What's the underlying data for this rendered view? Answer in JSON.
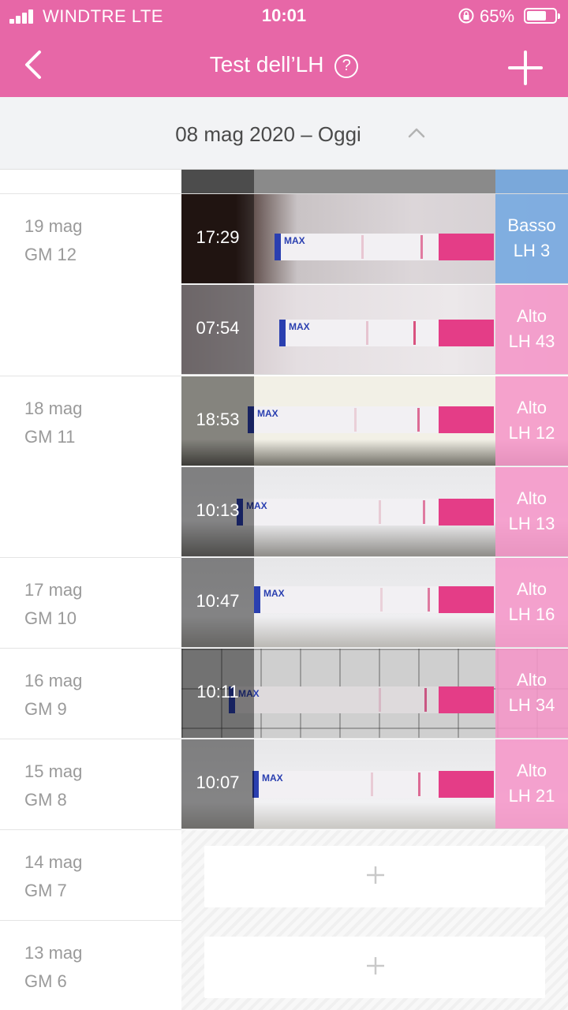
{
  "status": {
    "carrier": "WINDTRE  LTE",
    "time": "10:01",
    "battery_pct": "65%"
  },
  "nav": {
    "title": "Test dell’LH",
    "help_glyph": "?"
  },
  "datebar": {
    "range": "08 mag 2020 – Oggi"
  },
  "colors": {
    "header_pink": "#e767a7",
    "low_blue": "#78aae1",
    "high_pink": "#f596c8"
  },
  "days": [
    {
      "date": "19 mag",
      "gm": "GM 12",
      "tests": [
        {
          "time": "17:29",
          "level": "Basso",
          "lh": "LH 3",
          "status": "low"
        },
        {
          "time": "07:54",
          "level": "Alto",
          "lh": "LH 43",
          "status": "high"
        }
      ]
    },
    {
      "date": "18 mag",
      "gm": "GM 11",
      "tests": [
        {
          "time": "18:53",
          "level": "Alto",
          "lh": "LH 12",
          "status": "high"
        },
        {
          "time": "10:13",
          "level": "Alto",
          "lh": "LH 13",
          "status": "high"
        }
      ]
    },
    {
      "date": "17 mag",
      "gm": "GM 10",
      "tests": [
        {
          "time": "10:47",
          "level": "Alto",
          "lh": "LH 16",
          "status": "high"
        }
      ]
    },
    {
      "date": "16 mag",
      "gm": "GM 9",
      "tests": [
        {
          "time": "10:11",
          "level": "Alto",
          "lh": "LH 34",
          "status": "high"
        }
      ]
    },
    {
      "date": "15 mag",
      "gm": "GM 8",
      "tests": [
        {
          "time": "10:07",
          "level": "Alto",
          "lh": "LH 21",
          "status": "high"
        }
      ]
    },
    {
      "date": "14 mag",
      "gm": "GM 7",
      "tests": []
    },
    {
      "date": "13 mag",
      "gm": "GM 6",
      "tests": []
    }
  ],
  "strip_label": "MAX",
  "icons": {
    "back": "chevron-left-icon",
    "add": "plus-icon",
    "help": "question-circle-icon",
    "collapse": "chevron-up-icon"
  }
}
